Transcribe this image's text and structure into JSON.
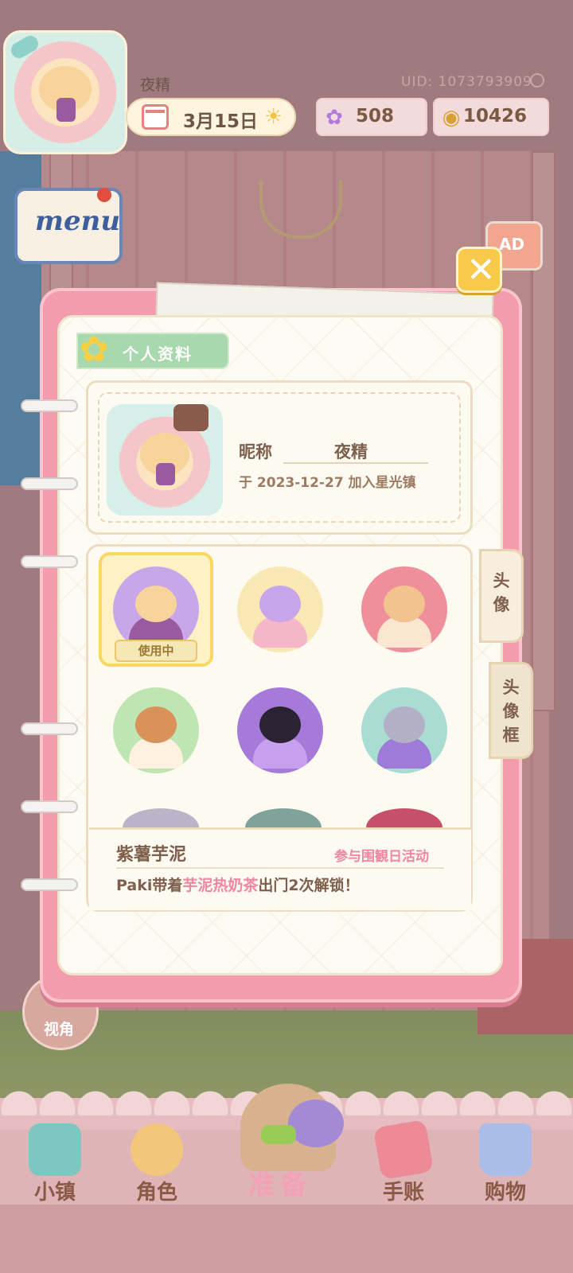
{
  "top_bar": {
    "nickname": "夜精",
    "uid": "UID: 1073793909",
    "date": "3月15日",
    "gems": "508",
    "coins": "10426"
  },
  "side_buttons": {
    "menu_label": "menu",
    "ad_label": "AD",
    "view_label": "视角"
  },
  "profile": {
    "section_title": "个人资料",
    "nickname_label": "昵称",
    "nickname_value": "夜精",
    "join_text": "于 2023-12-27 加入星光镇"
  },
  "avatar_grid": {
    "in_use_badge": "使用中",
    "items": [
      {
        "name": "hamster-avatar",
        "colors": [
          "#c9a6e8",
          "#f6d49c",
          "#9a5aa0"
        ]
      },
      {
        "name": "magic-hat-avatar",
        "colors": [
          "#f9e8b4",
          "#c8a4ea",
          "#f4b6c8"
        ]
      },
      {
        "name": "shiba-avatar",
        "colors": [
          "#f08f9c",
          "#f2c38f",
          "#fbe6d0"
        ]
      },
      {
        "name": "beagle-avatar",
        "colors": [
          "#bfe6b2",
          "#d9925a",
          "#fff1df"
        ]
      },
      {
        "name": "black-cat-avatar",
        "colors": [
          "#a57ad8",
          "#2b2233",
          "#c6a0ec"
        ]
      },
      {
        "name": "gray-cat-avatar",
        "colors": [
          "#a9dcd2",
          "#b3afc4",
          "#9e7bd6"
        ]
      }
    ]
  },
  "item_info": {
    "name": "紫薯芋泥",
    "source": "参与围観日活动",
    "desc_prefix": "Paki带着",
    "desc_highlight": "芋泥热奶茶",
    "desc_suffix": "出门2次解锁！"
  },
  "tabs": {
    "avatar": "头像",
    "frame": "头像框"
  },
  "bottom_nav": {
    "town": "小镇",
    "role": "角色",
    "prepare": "准备",
    "journal": "手账",
    "shop": "购物"
  },
  "colors": {
    "notebook_pink": "#f49cad",
    "highlight_pink": "#f086a0",
    "text_brown": "#7e5f4d",
    "selected_yellow": "#f8d862"
  }
}
